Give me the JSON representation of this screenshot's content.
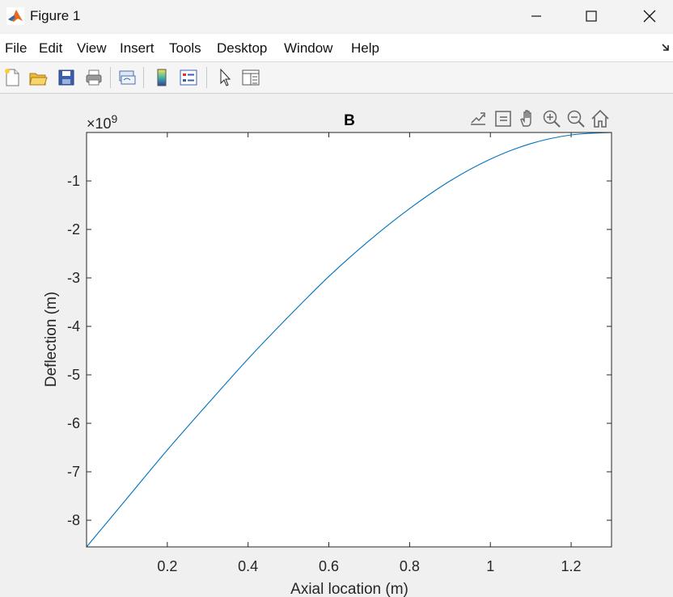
{
  "window": {
    "title": "Figure 1",
    "minimize_icon": "minimize-icon",
    "maximize_icon": "maximize-icon",
    "close_icon": "close-icon"
  },
  "menu": {
    "items": [
      "File",
      "Edit",
      "View",
      "Insert",
      "Tools",
      "Desktop",
      "Window",
      "Help"
    ]
  },
  "toolbar": {
    "icons": [
      "new-figure-icon",
      "open-file-icon",
      "save-icon",
      "print-icon",
      "link-plot-icon",
      "colorbar-icon",
      "legend-icon",
      "pointer-icon",
      "property-inspector-icon"
    ]
  },
  "axes_toolbar": {
    "icons": [
      "export-icon",
      "data-tips-icon",
      "pan-icon",
      "zoom-in-icon",
      "zoom-out-icon",
      "home-icon"
    ]
  },
  "colors": {
    "line": "#0072bd",
    "axes_bg": "#ffffff",
    "figure_bg": "#f0f0f0"
  },
  "chart_data": {
    "type": "line",
    "title": "B",
    "xlabel": "Axial location (m)",
    "ylabel": "Deflection (m)",
    "y_exponent_label": "×10",
    "y_exponent": "9",
    "xlim": [
      0,
      1.3
    ],
    "ylim": [
      -8.55,
      0
    ],
    "xticks": [
      0.2,
      0.4,
      0.6,
      0.8,
      1,
      1.2
    ],
    "xtick_labels": [
      "0.2",
      "0.4",
      "0.6",
      "0.8",
      "1",
      "1.2"
    ],
    "yticks": [
      -8,
      -7,
      -6,
      -5,
      -4,
      -3,
      -2,
      -1
    ],
    "ytick_labels": [
      "-8",
      "-7",
      "-6",
      "-5",
      "-4",
      "-3",
      "-2",
      "-1"
    ],
    "grid": false,
    "series": [
      {
        "x": [
          0,
          0.1,
          0.2,
          0.3,
          0.4,
          0.5,
          0.6,
          0.7,
          0.8,
          0.9,
          1.0,
          1.1,
          1.2,
          1.3
        ],
        "y": [
          -8.55,
          -7.55,
          -6.55,
          -5.6,
          -4.67,
          -3.8,
          -2.97,
          -2.23,
          -1.57,
          -1.0,
          -0.55,
          -0.23,
          -0.05,
          0
        ]
      }
    ]
  }
}
